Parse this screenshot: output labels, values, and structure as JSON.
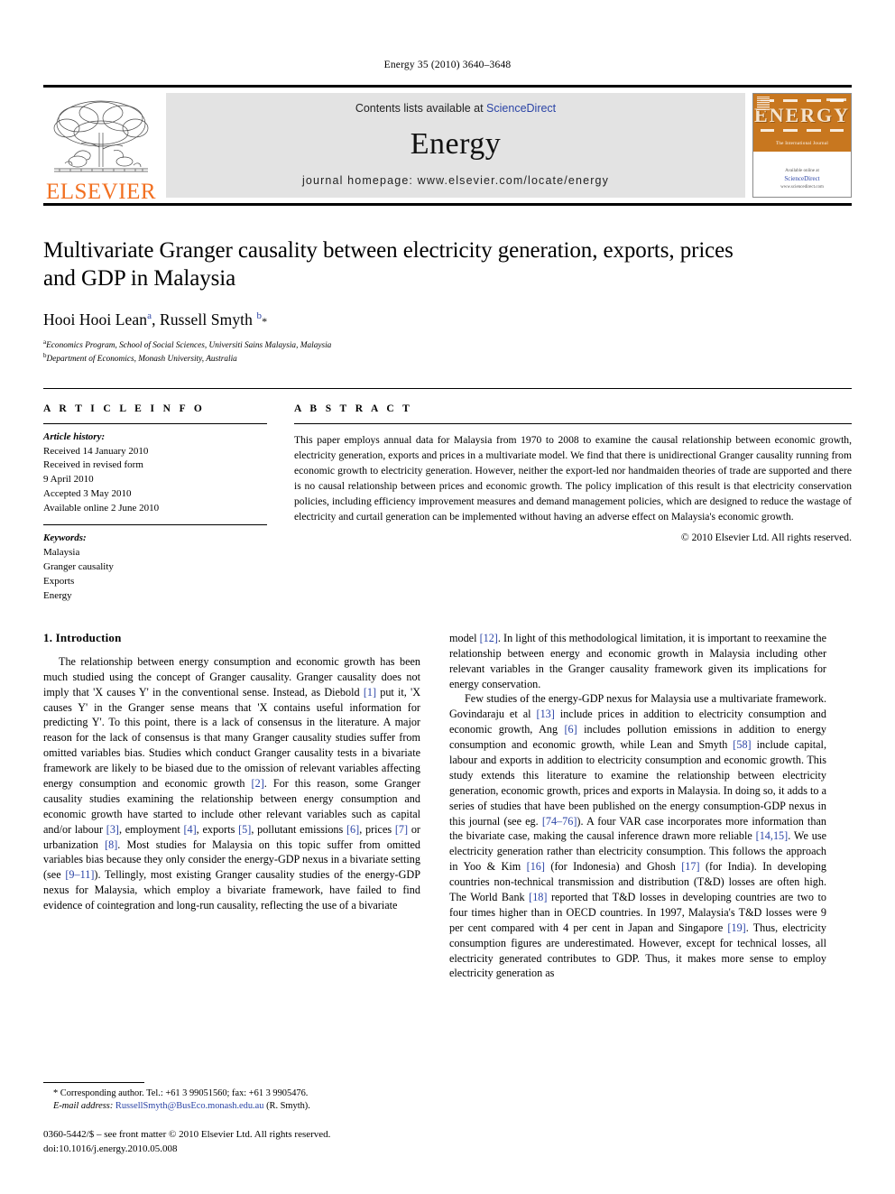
{
  "running_head": "Energy 35 (2010) 3640–3648",
  "masthead": {
    "publisher_name": "ELSEVIER",
    "contents_prefix": "Contents lists available at ",
    "contents_link": "ScienceDirect",
    "journal_name": "Energy",
    "homepage": "journal homepage: www.elsevier.com/locate/energy",
    "cover": {
      "title": "ENERGY",
      "subtitle": "The International Journal",
      "footer_line1": "Available online at",
      "footer_line2": "ScienceDirect",
      "footer_line3": "www.sciencedirect.com"
    },
    "link_color": "#2b44a6",
    "brand_color": "#F27021",
    "cover_color": "#C8771F"
  },
  "article": {
    "title": "Multivariate Granger causality between electricity generation, exports, prices and GDP in Malaysia",
    "authors": "Hooi Hooi Lean",
    "author_a_sup": "a",
    "author_2": ", Russell Smyth ",
    "author_b_sup": "b",
    "corresponding_mark": "*",
    "affiliation_a_sup": "a",
    "affiliation_a": "Economics Program, School of Social Sciences, Universiti Sains Malaysia, Malaysia",
    "affiliation_b_sup": "b",
    "affiliation_b": "Department of Economics, Monash University, Australia"
  },
  "article_info": {
    "heading": "A R T I C L E   I N F O",
    "history_label": "Article history:",
    "history": [
      "Received 14 January 2010",
      "Received in revised form",
      "9 April 2010",
      "Accepted 3 May 2010",
      "Available online 2 June 2010"
    ],
    "keywords_label": "Keywords:",
    "keywords": [
      "Malaysia",
      "Granger causality",
      "Exports",
      "Energy"
    ]
  },
  "abstract": {
    "heading": "A B S T R A C T",
    "text": "This paper employs annual data for Malaysia from 1970 to 2008 to examine the causal relationship between economic growth, electricity generation, exports and prices in a multivariate model. We find that there is unidirectional Granger causality running from economic growth to electricity generation. However, neither the export-led nor handmaiden theories of trade are supported and there is no causal relationship between prices and economic growth. The policy implication of this result is that electricity conservation policies, including efficiency improvement measures and demand management policies, which are designed to reduce the wastage of electricity and curtail generation can be implemented without having an adverse effect on Malaysia's economic growth.",
    "copyright": "© 2010 Elsevier Ltd. All rights reserved."
  },
  "body": {
    "section_number_title": "1.  Introduction",
    "left_paragraphs": [
      "The relationship between energy consumption and economic growth has been much studied using the concept of Granger causality. Granger causality does not imply that 'X causes Y' in the conventional sense. Instead, as Diebold [1] put it, 'X causes Y' in the Granger sense means that 'X contains useful information for predicting Y'. To this point, there is a lack of consensus in the literature. A major reason for the lack of consensus is that many Granger causality studies suffer from omitted variables bias. Studies which conduct Granger causality tests in a bivariate framework are likely to be biased due to the omission of relevant variables affecting energy consumption and economic growth [2]. For this reason, some Granger causality studies examining the relationship between energy consumption and economic growth have started to include other relevant variables such as capital and/or labour [3], employment [4], exports [5], pollutant emissions [6], prices [7] or urbanization [8]. Most studies for Malaysia on this topic suffer from omitted variables bias because they only consider the energy-GDP nexus in a bivariate setting (see [9–11]). Tellingly, most existing Granger causality studies of the energy-GDP nexus for Malaysia, which employ a bivariate framework, have failed to find evidence of cointegration and long-run causality, reflecting the use of a bivariate"
    ],
    "right_paragraphs": [
      "model [12]. In light of this methodological limitation, it is important to reexamine the relationship between energy and economic growth in Malaysia including other relevant variables in the Granger causality framework given its implications for energy conservation.",
      "Few studies of the energy-GDP nexus for Malaysia use a multivariate framework. Govindaraju et al [13] include prices in addition to electricity consumption and economic growth, Ang [6] includes pollution emissions in addition to energy consumption and economic growth, while Lean and Smyth [58] include capital, labour and exports in addition to electricity consumption and economic growth. This study extends this literature to examine the relationship between electricity generation, economic growth, prices and exports in Malaysia. In doing so, it adds to a series of studies that have been published on the energy consumption-GDP nexus in this journal (see eg. [74–76]). A four VAR case incorporates more information than the bivariate case, making the causal inference drawn more reliable [14,15]. We use electricity generation rather than electricity consumption. This follows the approach in Yoo & Kim [16] (for Indonesia) and Ghosh [17] (for India). In developing countries non-technical transmission and distribution (T&D) losses are often high. The World Bank [18] reported that T&D losses in developing countries are two to four times higher than in OECD countries. In 1997, Malaysia's T&D losses were 9 per cent compared with 4 per cent in Japan and Singapore [19]. Thus, electricity consumption figures are underestimated. However, except for technical losses, all electricity generated contributes to GDP. Thus, it makes more sense to employ electricity generation as"
    ]
  },
  "footnote": {
    "corresponding": "* Corresponding author. Tel.: +61 3 99051560; fax: +61 3 9905476.",
    "email_label": "E-mail address:",
    "email": "RussellSmyth@BusEco.monash.edu.au",
    "email_suffix": "(R. Smyth)."
  },
  "footer": {
    "issn_line": "0360-5442/$ – see front matter © 2010 Elsevier Ltd. All rights reserved.",
    "doi_line": "doi:10.1016/j.energy.2010.05.008"
  }
}
